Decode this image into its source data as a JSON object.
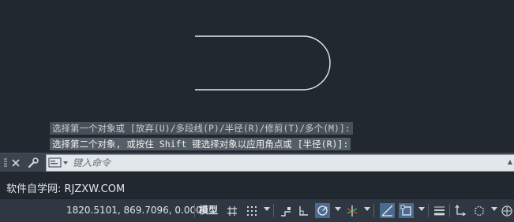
{
  "command_history": {
    "line1": "选择第一个对象或 [放弃(U)/多段线(P)/半径(R)/修剪(T)/多个(M)]:",
    "line2": "选择第二个对象, 或按住 Shift 键选择对象以应用角点或 [半径(R)]:"
  },
  "command_bar": {
    "placeholder": "键入命令"
  },
  "watermark": "软件自学网: RJZXW.COM",
  "status_bar": {
    "coordinates": "1820.5101, 869.7096, 0.0000",
    "model_label": "模型"
  },
  "colors": {
    "canvas_bg": "#212830",
    "geometry_stroke": "#e6e8eb",
    "active_toggle": "#4a6b8f"
  }
}
